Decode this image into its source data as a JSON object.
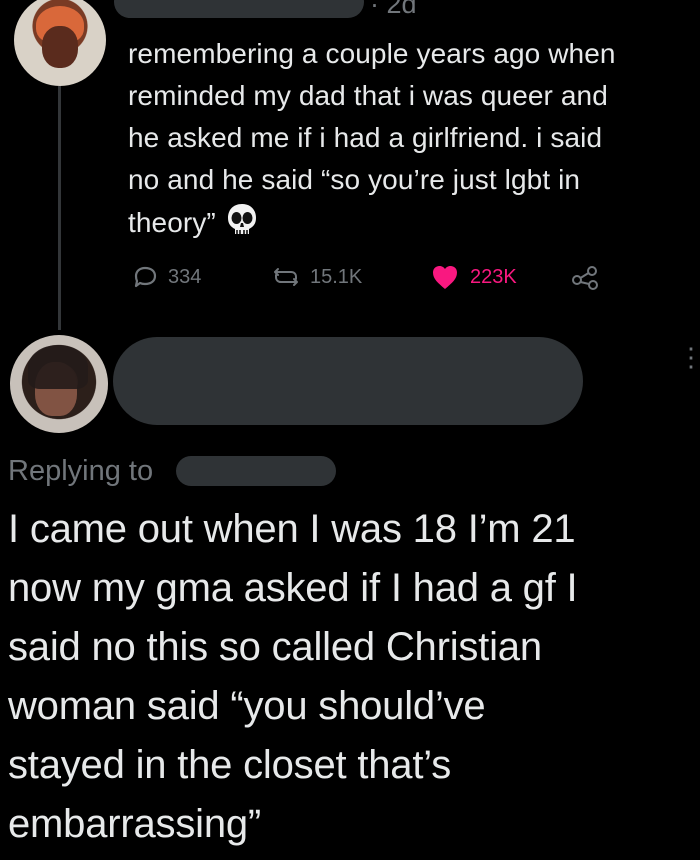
{
  "first_tweet": {
    "time": "· 2d",
    "text": "remembering a couple years ago when\nreminded my dad that i was queer and\nhe asked me if i had a girlfriend. i said\nno and he said “so you’re just lgbt in\ntheory”",
    "emoji_icon": "skull-icon",
    "metrics": {
      "replies": "334",
      "retweets": "15.1K",
      "likes": "223K"
    },
    "colors": {
      "like": "#f91880",
      "muted": "#71767b"
    }
  },
  "second_tweet": {
    "replying_to_label": "Replying to",
    "text": "I came out when I was 18 I’m 21\nnow my gma asked if I had a gf I\nsaid no this so called Christian\nwoman said “you should’ve\nstayed in the closet that’s\nembarrassing”"
  }
}
